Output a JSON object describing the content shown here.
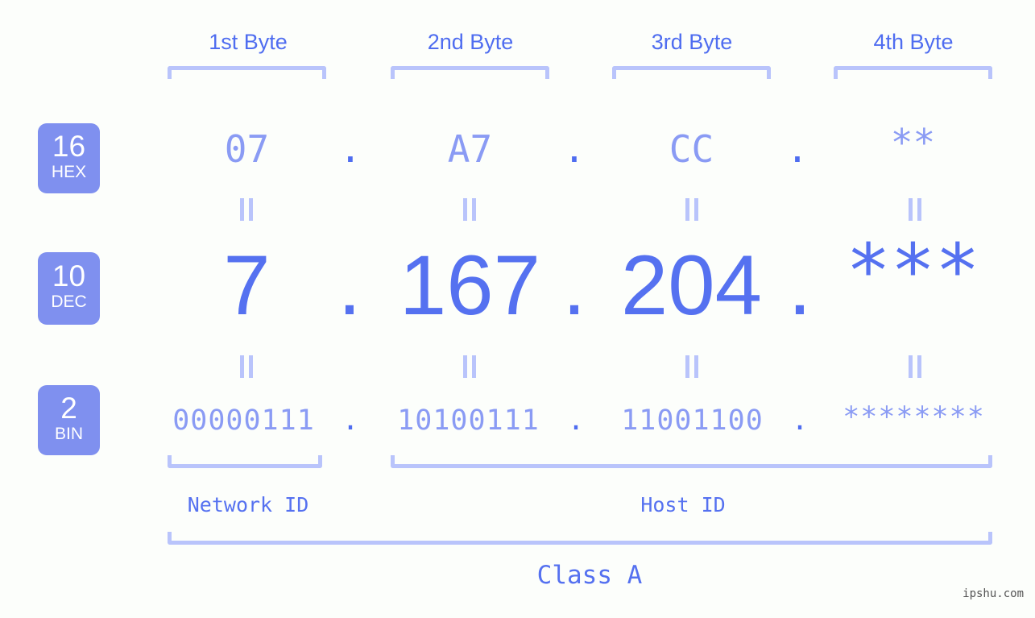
{
  "background_color": "#fcfefb",
  "accent_color": "#5571f0",
  "muted_accent_color": "#8a9bf4",
  "bracket_color": "#b9c4fb",
  "badge_color": "#7f90ef",
  "byte_headers": [
    {
      "label": "1st Byte"
    },
    {
      "label": "2nd Byte"
    },
    {
      "label": "3rd Byte"
    },
    {
      "label": "4th Byte"
    }
  ],
  "rows": {
    "hex": {
      "badge_number": "16",
      "badge_name": "HEX",
      "values": [
        "07",
        "A7",
        "CC",
        "**"
      ],
      "separator": "."
    },
    "dec": {
      "badge_number": "10",
      "badge_name": "DEC",
      "values": [
        "7",
        "167",
        "204",
        "***"
      ],
      "separator": "."
    },
    "bin": {
      "badge_number": "2",
      "badge_name": "BIN",
      "values": [
        "00000111",
        "10100111",
        "11001100",
        "********"
      ],
      "separator": "."
    }
  },
  "equality_mark": "‖",
  "id_labels": {
    "network": "Network ID",
    "host": "Host ID"
  },
  "class_label": "Class A",
  "watermark": "ipshu.com"
}
